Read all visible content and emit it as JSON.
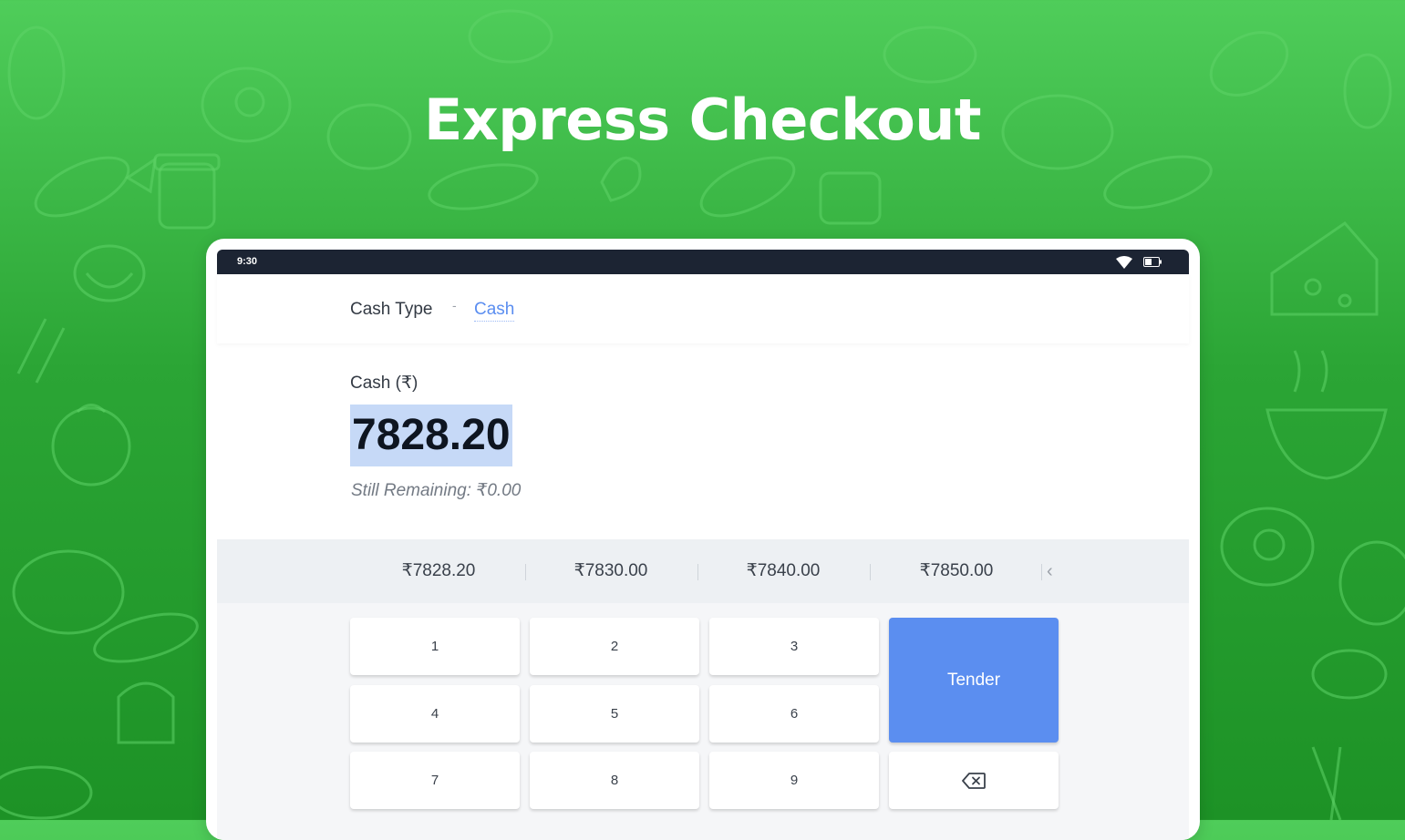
{
  "headline": "Express Checkout",
  "status_bar": {
    "time": "9:30",
    "icons": [
      "wifi-icon",
      "battery-icon"
    ]
  },
  "cash_type": {
    "label": "Cash Type",
    "separator": "-",
    "value": "Cash"
  },
  "cash": {
    "label": "Cash (₹)",
    "amount": "7828.20",
    "remaining": "Still Remaining: ₹0.00"
  },
  "quick_amounts": [
    "₹7828.20",
    "₹7830.00",
    "₹7840.00",
    "₹7850.00"
  ],
  "quick_amounts_prev_icon": "‹",
  "keypad": {
    "keys": [
      "1",
      "2",
      "3",
      "4",
      "5",
      "6",
      "7",
      "8",
      "9"
    ],
    "tender_label": "Tender",
    "backspace_icon": "backspace-icon"
  },
  "colors": {
    "background_green": "#2ba535",
    "accent_blue": "#5b8ef0",
    "status_bar": "#1c2433",
    "amount_highlight": "#c6d9f7"
  }
}
